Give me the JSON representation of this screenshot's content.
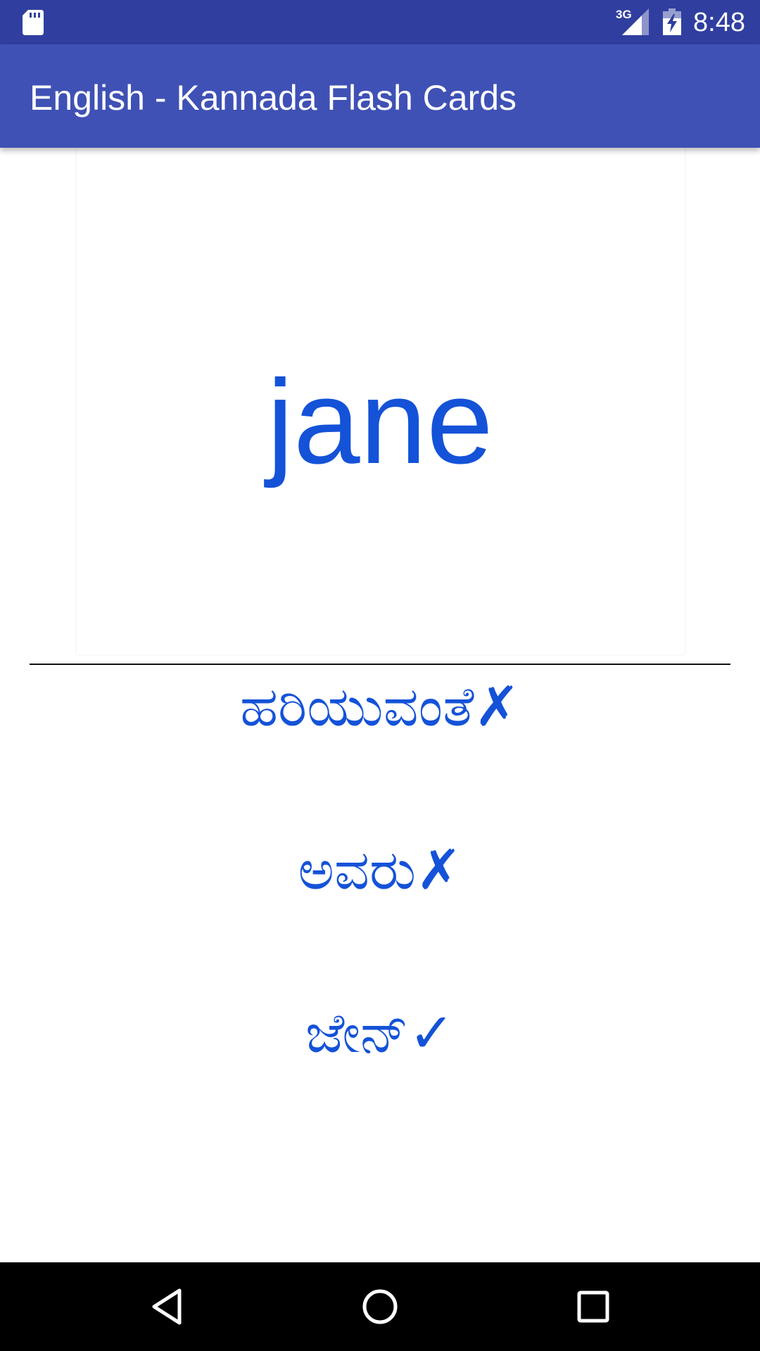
{
  "status_bar": {
    "network_type": "3G",
    "time": "8:48",
    "icons": [
      "sd-card-icon",
      "signal-icon",
      "battery-charging-icon"
    ]
  },
  "app_bar": {
    "title": "English - Kannada Flash Cards"
  },
  "card": {
    "word": "jane"
  },
  "options": [
    {
      "text": "ಹರಿಯುವಂತೆ",
      "mark": "✗",
      "correct": false
    },
    {
      "text": "ಅವರು",
      "mark": "✗",
      "correct": false
    },
    {
      "text": "ಜೇನ್",
      "mark": "✓",
      "correct": true
    }
  ],
  "nav_bar": {
    "icons": [
      "back-icon",
      "home-icon",
      "recent-apps-icon"
    ]
  },
  "colors": {
    "status_bar": "#303f9f",
    "app_bar": "#3f51b5",
    "text_accent": "#1452d8"
  }
}
